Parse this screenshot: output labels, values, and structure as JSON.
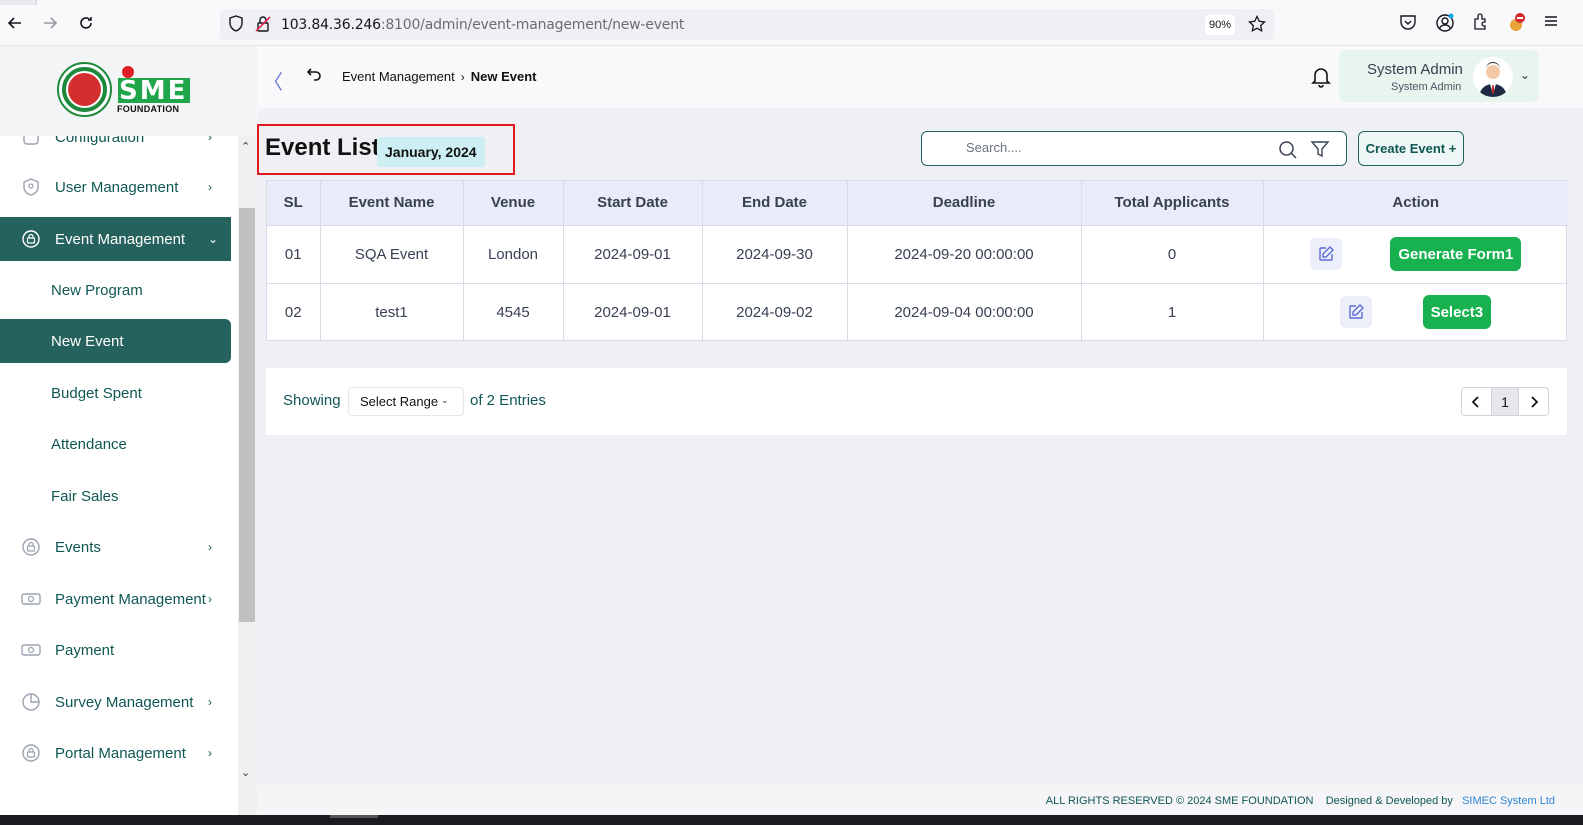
{
  "browser": {
    "url_host": "103.84.36.246",
    "url_path": ":8100/admin/event-management/new-event",
    "zoom": "90%"
  },
  "sidebar": {
    "logo_text": "SME",
    "logo_subtext": "FOUNDATION",
    "items": [
      {
        "label": "Configuration",
        "icon": "config-icon"
      },
      {
        "label": "User Management",
        "icon": "shield-icon"
      },
      {
        "label": "Event Management",
        "icon": "lock-icon",
        "active": true
      },
      {
        "label": "Events",
        "icon": "lock-icon"
      },
      {
        "label": "Payment Management",
        "icon": "cash-icon"
      },
      {
        "label": "Payment",
        "icon": "cash-icon"
      },
      {
        "label": "Survey Management",
        "icon": "pie-icon"
      },
      {
        "label": "Portal Management",
        "icon": "lock-icon"
      }
    ],
    "subitems": [
      {
        "label": "New Program"
      },
      {
        "label": "New Event",
        "active": true
      },
      {
        "label": "Budget Spent"
      },
      {
        "label": "Attendance"
      },
      {
        "label": "Fair Sales"
      }
    ]
  },
  "header": {
    "breadcrumb_parent": "Event Management",
    "breadcrumb_current": "New Event",
    "user_name": "System Admin",
    "user_role": "System Admin"
  },
  "main": {
    "title": "Event List",
    "month": "January, 2024",
    "search_placeholder": "Search....",
    "create_label": "Create Event +",
    "columns": [
      "SL",
      "Event Name",
      "Venue",
      "Start Date",
      "End Date",
      "Deadline",
      "Total Applicants",
      "Action"
    ],
    "rows": [
      {
        "sl": "01",
        "name": "SQA Event",
        "venue": "London",
        "start": "2024-09-01",
        "end": "2024-09-30",
        "deadline": "2024-09-20 00:00:00",
        "applicants": "0",
        "action_label": "Generate Form1"
      },
      {
        "sl": "02",
        "name": "test1",
        "venue": "4545",
        "start": "2024-09-01",
        "end": "2024-09-02",
        "deadline": "2024-09-04 00:00:00",
        "applicants": "1",
        "action_label": "Select3"
      }
    ],
    "showing_label": "Showing",
    "range_label": "Select Range",
    "entries_label": "of 2 Entries",
    "current_page": "1"
  },
  "footer": {
    "rights": "ALL RIGHTS RESERVED © 2024 SME FOUNDATION",
    "designed": "Designed & Developed by",
    "company": "SIMEC System Ltd"
  },
  "colors": {
    "primary": "#26625d",
    "accent_green": "#18b14f",
    "highlight_red": "#e0191f"
  }
}
